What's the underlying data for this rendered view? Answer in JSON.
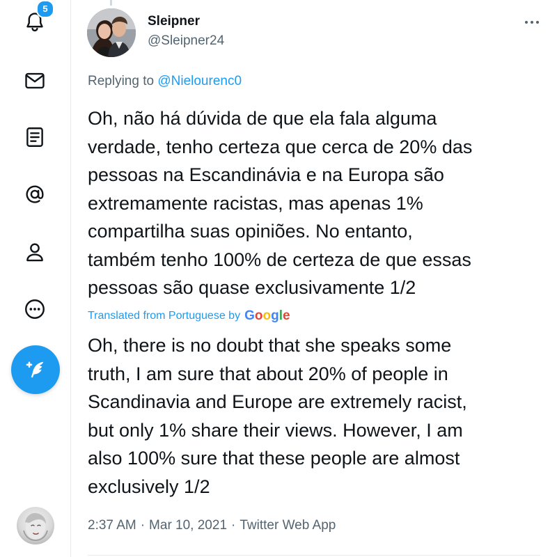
{
  "sidebar": {
    "notifications_badge": "5",
    "items": [
      {
        "icon": "bell-icon"
      },
      {
        "icon": "mail-icon"
      },
      {
        "icon": "lists-icon"
      },
      {
        "icon": "at-icon"
      },
      {
        "icon": "profile-icon"
      },
      {
        "icon": "more-circle-icon"
      }
    ],
    "compose_icon": "feather-plus-icon"
  },
  "tweet": {
    "display_name": "Sleipner",
    "handle": "@Sleipner24",
    "replying_prefix": "Replying to ",
    "replying_to": "@Nielourenc0",
    "original_text": "Oh, não há dúvida de que ela fala alguma\nverdade, tenho certeza que cerca de 20% das\npessoas na Escandinávia e na Europa são\nextremamente racistas, mas apenas 1%\ncompartilha suas opiniões. No entanto,\ntambém tenho 100% de certeza de que essas\npessoas são quase exclusivamente 1/2",
    "translated_from": "Translated from Portuguese by",
    "translator_logo": "Google",
    "translated_text": "Oh, there is no doubt that she speaks some\ntruth, I am sure that about 20% of people in\nScandinavia and Europe are extremely racist,\nbut only 1% share their views. However, I am\nalso 100% sure that these people are almost\nexclusively 1/2",
    "time": "2:37 AM",
    "date": "Mar 10, 2021",
    "source": "Twitter Web App",
    "separator": "·"
  },
  "colors": {
    "accent": "#1d9bf0",
    "text": "#0f1419",
    "muted": "#536471",
    "divider": "#e6ecf0"
  }
}
